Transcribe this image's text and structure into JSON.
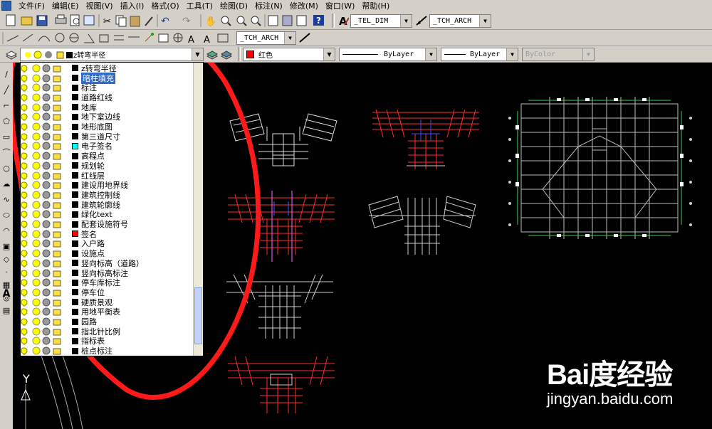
{
  "menu": [
    "文件(F)",
    "编辑(E)",
    "视图(V)",
    "插入(I)",
    "格式(O)",
    "工具(T)",
    "绘图(D)",
    "标注(N)",
    "修改(M)",
    "窗口(W)",
    "帮助(H)"
  ],
  "toolbar": {
    "textstyle_combo": "_TEL_DIM",
    "dimstyle_combo": "_TCH_ARCH",
    "second_row_combo": "_TCH_ARCH"
  },
  "properties": {
    "current_layer": "z转弯半径",
    "color": "红色",
    "linetype": "ByLayer",
    "lineweight": "ByLayer",
    "plotstyle": "ByColor"
  },
  "layers": [
    {
      "name": "z转弯半径",
      "color": "#000000",
      "selected": false
    },
    {
      "name": "暗柱填充",
      "color": "#000000",
      "selected": true
    },
    {
      "name": "标注",
      "color": "#000000",
      "selected": false
    },
    {
      "name": "道路红线",
      "color": "#000000",
      "selected": false
    },
    {
      "name": "地库",
      "color": "#000000",
      "selected": false
    },
    {
      "name": "地下室边线",
      "color": "#000000",
      "selected": false
    },
    {
      "name": "地形底图",
      "color": "#000000",
      "selected": false
    },
    {
      "name": "第三道尺寸",
      "color": "#000000",
      "selected": false
    },
    {
      "name": "电子签名",
      "color": "#00ffff",
      "selected": false
    },
    {
      "name": "高程点",
      "color": "#000000",
      "selected": false
    },
    {
      "name": "规划轮",
      "color": "#000000",
      "selected": false
    },
    {
      "name": "红线层",
      "color": "#000000",
      "selected": false
    },
    {
      "name": "建设用地界线",
      "color": "#000000",
      "selected": false
    },
    {
      "name": "建筑控制线",
      "color": "#000000",
      "selected": false
    },
    {
      "name": "建筑轮廓线",
      "color": "#000000",
      "selected": false
    },
    {
      "name": "绿化text",
      "color": "#000000",
      "selected": false
    },
    {
      "name": "配套设施符号",
      "color": "#000000",
      "selected": false
    },
    {
      "name": "签名",
      "color": "#ff0000",
      "selected": false
    },
    {
      "name": "入户路",
      "color": "#000000",
      "selected": false
    },
    {
      "name": "设施点",
      "color": "#000000",
      "selected": false
    },
    {
      "name": "竖向标高（道路）",
      "color": "#000000",
      "selected": false
    },
    {
      "name": "竖向标高标注",
      "color": "#000000",
      "selected": false
    },
    {
      "name": "停车库标注",
      "color": "#000000",
      "selected": false
    },
    {
      "name": "停车位",
      "color": "#000000",
      "selected": false
    },
    {
      "name": "硬质景观",
      "color": "#000000",
      "selected": false
    },
    {
      "name": "用地平衡表",
      "color": "#000000",
      "selected": false
    },
    {
      "name": "园路",
      "color": "#000000",
      "selected": false
    },
    {
      "name": "指北针比例",
      "color": "#000000",
      "selected": false
    },
    {
      "name": "指标表",
      "color": "#000000",
      "selected": false
    },
    {
      "name": "桩点标注",
      "color": "#000000",
      "selected": false
    }
  ],
  "watermark": {
    "logo": "Bai度经验",
    "url": "jingyan.baidu.com"
  },
  "ucs_label": "Y",
  "colors": {
    "annotation_circle": "#ff0000",
    "toolbar_bg": "#d4d0c8",
    "drawing_bg": "#000000",
    "selection": "#316ac5"
  }
}
